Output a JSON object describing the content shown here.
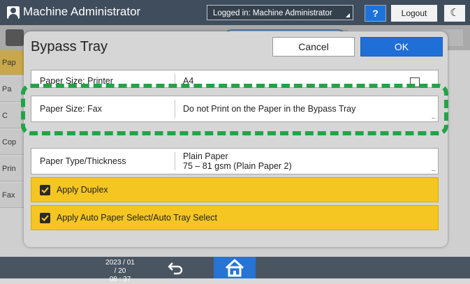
{
  "topbar": {
    "user_name": "Machine Administrator",
    "logged_in": "Logged in: Machine Administrator",
    "help_label": "?",
    "logout_label": "Logout",
    "moon_icon": "moon-icon"
  },
  "background": {
    "tabs": [
      "Pap",
      "Pa",
      "C",
      "Cop",
      "Prin",
      "Fax"
    ]
  },
  "dialog": {
    "title": "Bypass Tray",
    "cancel_label": "Cancel",
    "ok_label": "OK",
    "rows": [
      {
        "label": "Paper Size: Printer",
        "value": "A4"
      },
      {
        "label": "Paper Size: Fax",
        "value": "Do not Print on the Paper in the Bypass Tray"
      },
      {
        "label": "Paper Type/Thickness",
        "value_line1": "Plain Paper",
        "value_line2": "75 – 81 gsm (Plain Paper 2)"
      }
    ],
    "more_glyph": "...",
    "checks": [
      {
        "label": "Apply Duplex",
        "checked": true
      },
      {
        "label": "Apply Auto Paper Select/Auto Tray Select",
        "checked": true
      }
    ],
    "checked_color": "#f5c622",
    "highlight_color": "#23a347"
  },
  "bottombar": {
    "date": "2023 / 01 / 20",
    "time": "08 : 37",
    "back_icon": "back-arrow-icon",
    "home_icon": "home-icon",
    "home_color": "#2774d4"
  }
}
